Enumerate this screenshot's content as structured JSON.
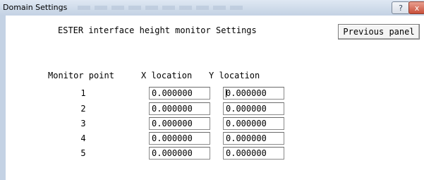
{
  "window": {
    "title": "Domain Settings",
    "help_label": "?",
    "close_label": "x"
  },
  "panel": {
    "title": "ESTER interface height monitor Settings",
    "previous_button": "Previous panel"
  },
  "table": {
    "headers": [
      "Monitor point",
      "X location",
      "Y location"
    ],
    "rows": [
      {
        "point": "1",
        "x": "0.000000",
        "y": "0.000000"
      },
      {
        "point": "2",
        "x": "0.000000",
        "y": "0.000000"
      },
      {
        "point": "3",
        "x": "0.000000",
        "y": "0.000000"
      },
      {
        "point": "4",
        "x": "0.000000",
        "y": "0.000000"
      },
      {
        "point": "5",
        "x": "0.000000",
        "y": "0.000000"
      }
    ]
  },
  "colors": {
    "titlebar": "#cfdbea",
    "close_button": "#c9503a",
    "background": "#ffffff"
  }
}
